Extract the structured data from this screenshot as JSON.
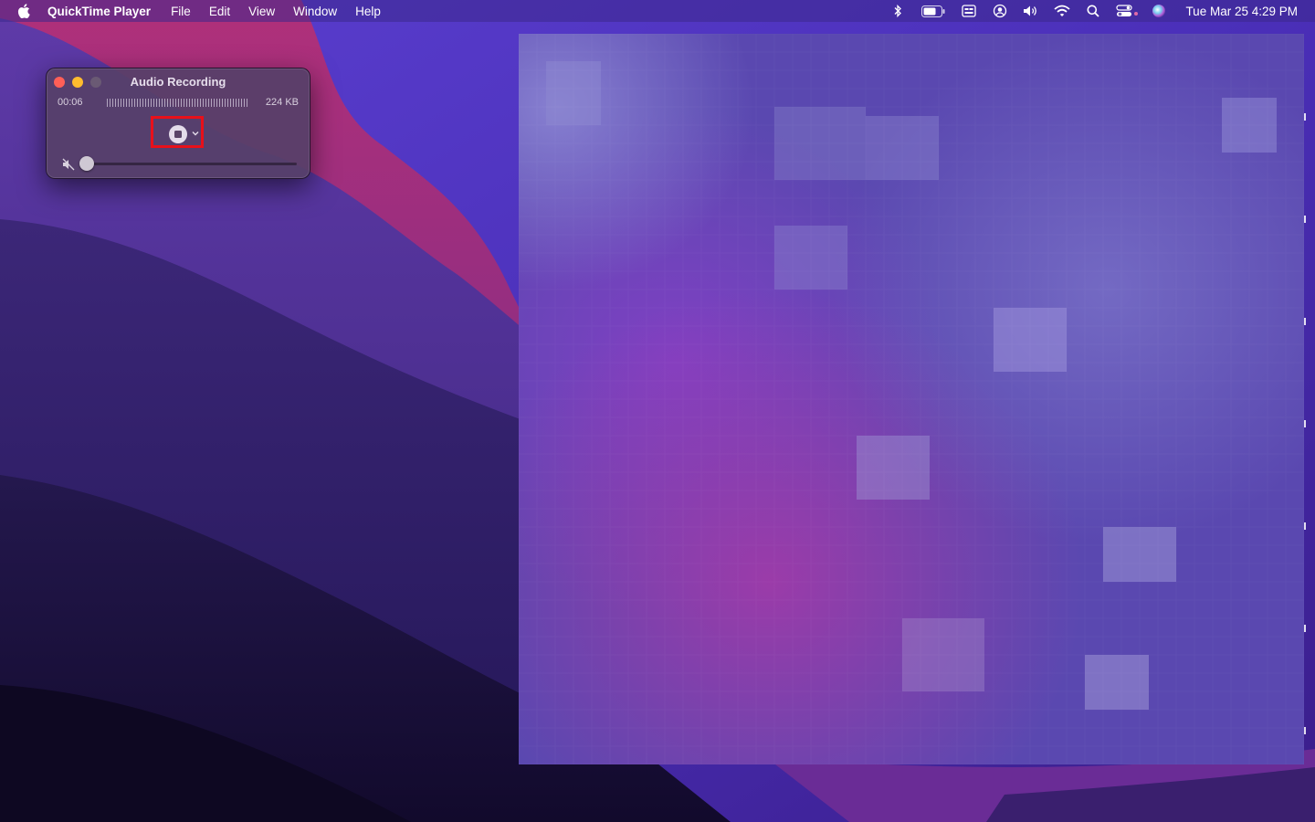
{
  "menubar": {
    "apple_icon": "apple-logo-icon",
    "app_name": "QuickTime Player",
    "menus": [
      "File",
      "Edit",
      "View",
      "Window",
      "Help"
    ],
    "status_icons": [
      "bluetooth-icon",
      "battery-icon",
      "input-menu-icon",
      "user-icon",
      "volume-icon",
      "wifi-icon",
      "spotlight-search-icon",
      "control-center-icon",
      "siri-icon"
    ],
    "clock": "Tue Mar 25  4:29 PM"
  },
  "recording_window": {
    "title": "Audio Recording",
    "elapsed": "00:06",
    "file_size": "224 KB",
    "volume_level": 0.0,
    "muted": true
  },
  "colors": {
    "highlight": "#e8101a",
    "close": "#ff5f57",
    "minimize": "#febc2e"
  }
}
